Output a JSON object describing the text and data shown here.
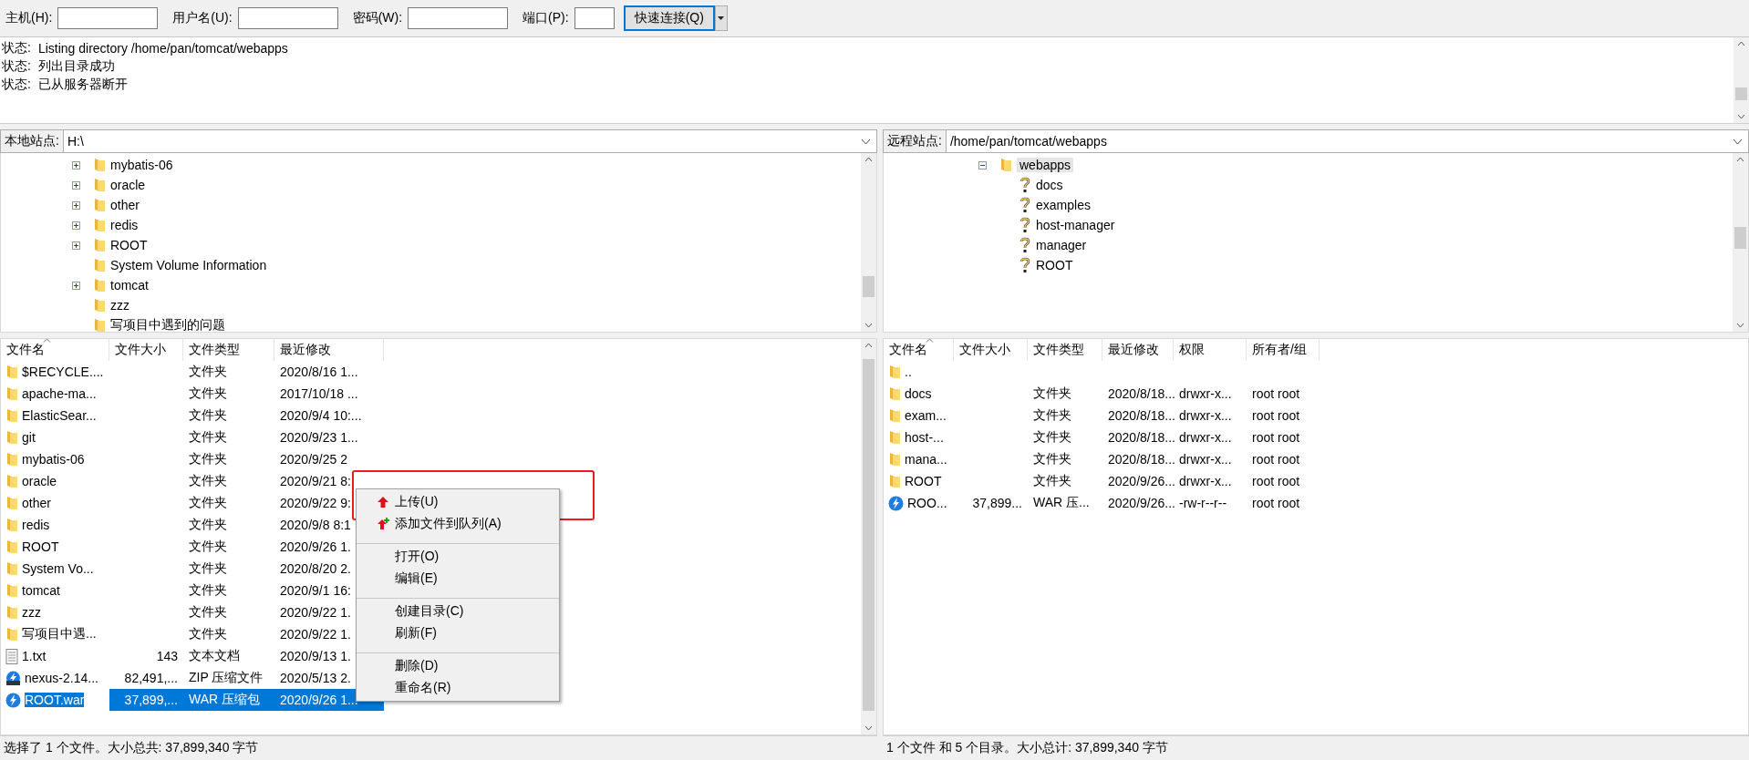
{
  "toolbar": {
    "fields": [
      {
        "label": "主机(H):"
      },
      {
        "label": "用户名(U):"
      },
      {
        "label": "密码(W):"
      },
      {
        "label": "端口(P):"
      }
    ],
    "connect_button": "快速连接(Q)"
  },
  "log": [
    {
      "label": "状态:",
      "message": "Listing directory /home/pan/tomcat/webapps"
    },
    {
      "label": "状态:",
      "message": "列出目录成功"
    },
    {
      "label": "状态:",
      "message": "已从服务器断开"
    }
  ],
  "local": {
    "site_label": "本地站点:",
    "path": "H:\\",
    "tree": [
      {
        "name": "mybatis-06",
        "expandable": true
      },
      {
        "name": "oracle",
        "expandable": true
      },
      {
        "name": "other",
        "expandable": true
      },
      {
        "name": "redis",
        "expandable": true
      },
      {
        "name": "ROOT",
        "expandable": true
      },
      {
        "name": "System Volume Information",
        "expandable": false
      },
      {
        "name": "tomcat",
        "expandable": true
      },
      {
        "name": "zzz",
        "expandable": false
      },
      {
        "name": "写项目中遇到的问题",
        "expandable": false
      }
    ],
    "columns": [
      "文件名",
      "文件大小",
      "文件类型",
      "最近修改"
    ],
    "rows": [
      {
        "kind": "folder",
        "name": "$RECYCLE....",
        "size": "",
        "type": "文件夹",
        "modified": "2020/8/16 1...",
        "selected": false
      },
      {
        "kind": "folder",
        "name": "apache-ma...",
        "size": "",
        "type": "文件夹",
        "modified": "2017/10/18 ...",
        "selected": false
      },
      {
        "kind": "folder",
        "name": "ElasticSear...",
        "size": "",
        "type": "文件夹",
        "modified": "2020/9/4 10:...",
        "selected": false
      },
      {
        "kind": "folder",
        "name": "git",
        "size": "",
        "type": "文件夹",
        "modified": "2020/9/23 1...",
        "selected": false
      },
      {
        "kind": "folder",
        "name": "mybatis-06",
        "size": "",
        "type": "文件夹",
        "modified": "2020/9/25 2",
        "selected": false
      },
      {
        "kind": "folder",
        "name": "oracle",
        "size": "",
        "type": "文件夹",
        "modified": "2020/9/21 8:",
        "selected": false
      },
      {
        "kind": "folder",
        "name": "other",
        "size": "",
        "type": "文件夹",
        "modified": "2020/9/22 9:",
        "selected": false
      },
      {
        "kind": "folder",
        "name": "redis",
        "size": "",
        "type": "文件夹",
        "modified": "2020/9/8 8:1",
        "selected": false
      },
      {
        "kind": "folder",
        "name": "ROOT",
        "size": "",
        "type": "文件夹",
        "modified": "2020/9/26 1.",
        "selected": false
      },
      {
        "kind": "folder",
        "name": "System Vo...",
        "size": "",
        "type": "文件夹",
        "modified": "2020/8/20 2.",
        "selected": false
      },
      {
        "kind": "folder",
        "name": "tomcat",
        "size": "",
        "type": "文件夹",
        "modified": "2020/9/1 16:",
        "selected": false
      },
      {
        "kind": "folder",
        "name": "zzz",
        "size": "",
        "type": "文件夹",
        "modified": "2020/9/22 1.",
        "selected": false
      },
      {
        "kind": "folder",
        "name": "写项目中遇...",
        "size": "",
        "type": "文件夹",
        "modified": "2020/9/22 1.",
        "selected": false
      },
      {
        "kind": "text",
        "name": "1.txt",
        "size": "143",
        "type": "文本文档",
        "modified": "2020/9/13 1.",
        "selected": false
      },
      {
        "kind": "zip",
        "name": "nexus-2.14...",
        "size": "82,491,...",
        "type": "ZIP 压缩文件",
        "modified": "2020/5/13 2.",
        "selected": false
      },
      {
        "kind": "war",
        "name": "ROOT.war",
        "size": "37,899,...",
        "type": "WAR 压缩包",
        "modified": "2020/9/26 1...",
        "selected": true
      }
    ],
    "status": "选择了 1 个文件。大小总共: 37,899,340 字节"
  },
  "remote": {
    "site_label": "远程站点:",
    "path": "/home/pan/tomcat/webapps",
    "tree": [
      {
        "name": "webapps",
        "kind": "folder",
        "expanded": true,
        "selected": true,
        "children": [
          {
            "name": "docs",
            "kind": "unknown",
            "selected": false
          },
          {
            "name": "examples",
            "kind": "unknown",
            "selected": false
          },
          {
            "name": "host-manager",
            "kind": "unknown",
            "selected": false
          },
          {
            "name": "manager",
            "kind": "unknown",
            "selected": false
          },
          {
            "name": "ROOT",
            "kind": "unknown",
            "selected": false
          }
        ]
      }
    ],
    "columns": [
      "文件名",
      "文件大小",
      "文件类型",
      "最近修改",
      "权限",
      "所有者/组"
    ],
    "rows": [
      {
        "kind": "folder",
        "name": "..",
        "size": "",
        "type": "",
        "modified": "",
        "permissions": "",
        "owner": ""
      },
      {
        "kind": "folder",
        "name": "docs",
        "size": "",
        "type": "文件夹",
        "modified": "2020/8/18...",
        "permissions": "drwxr-x...",
        "owner": "root root"
      },
      {
        "kind": "folder",
        "name": "exam...",
        "size": "",
        "type": "文件夹",
        "modified": "2020/8/18...",
        "permissions": "drwxr-x...",
        "owner": "root root"
      },
      {
        "kind": "folder",
        "name": "host-...",
        "size": "",
        "type": "文件夹",
        "modified": "2020/8/18...",
        "permissions": "drwxr-x...",
        "owner": "root root"
      },
      {
        "kind": "folder",
        "name": "mana...",
        "size": "",
        "type": "文件夹",
        "modified": "2020/8/18...",
        "permissions": "drwxr-x...",
        "owner": "root root"
      },
      {
        "kind": "folder",
        "name": "ROOT",
        "size": "",
        "type": "文件夹",
        "modified": "2020/9/26...",
        "permissions": "drwxr-x...",
        "owner": "root root"
      },
      {
        "kind": "war",
        "name": "ROO...",
        "size": "37,899...",
        "type": "WAR 压...",
        "modified": "2020/9/26...",
        "permissions": "-rw-r--r--",
        "owner": "root root"
      }
    ],
    "status": "1 个文件 和 5 个目录。大小总计: 37,899,340 字节"
  },
  "context_menu": [
    {
      "label": "上传(U)",
      "kind": "upload",
      "separator_before": false
    },
    {
      "label": "添加文件到队列(A)",
      "kind": "queue",
      "separator_before": false
    },
    {
      "label": "打开(O)",
      "kind": "plain",
      "separator_before": true
    },
    {
      "label": "编辑(E)",
      "kind": "plain",
      "separator_before": false
    },
    {
      "label": "创建目录(C)",
      "kind": "plain",
      "separator_before": true
    },
    {
      "label": "刷新(F)",
      "kind": "plain",
      "separator_before": false
    },
    {
      "label": "删除(D)",
      "kind": "plain",
      "separator_before": true
    },
    {
      "label": "重命名(R)",
      "kind": "plain",
      "separator_before": false
    }
  ]
}
